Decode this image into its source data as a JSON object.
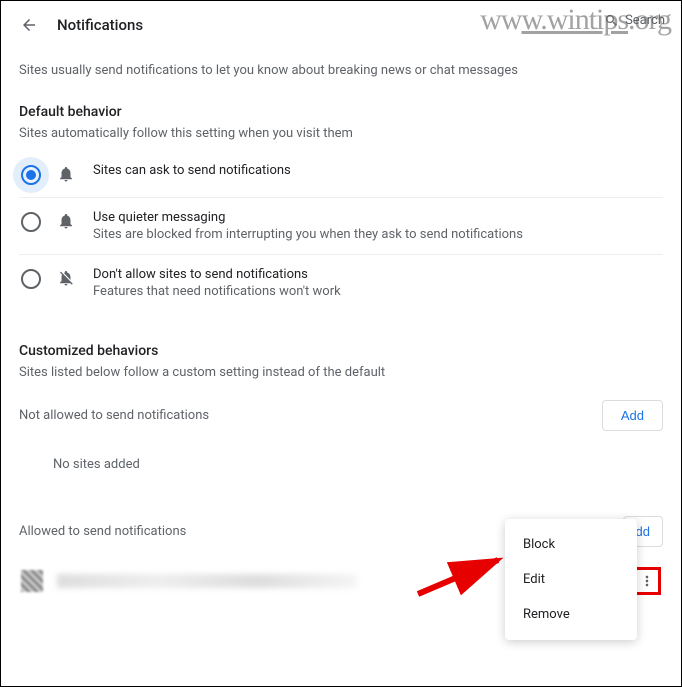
{
  "watermark": "www.wintips.org",
  "header": {
    "title": "Notifications",
    "search_placeholder": "Search"
  },
  "intro": "Sites usually send notifications to let you know about breaking news or chat messages",
  "default_behavior": {
    "title": "Default behavior",
    "desc": "Sites automatically follow this setting when you visit them",
    "options": [
      {
        "label": "Sites can ask to send notifications",
        "sub": "",
        "selected": true,
        "icon": "bell"
      },
      {
        "label": "Use quieter messaging",
        "sub": "Sites are blocked from interrupting you when they ask to send notifications",
        "selected": false,
        "icon": "bell"
      },
      {
        "label": "Don't allow sites to send notifications",
        "sub": "Features that need notifications won't work",
        "selected": false,
        "icon": "bell-off"
      }
    ]
  },
  "custom": {
    "title": "Customized behaviors",
    "desc": "Sites listed below follow a custom setting instead of the default"
  },
  "blocked_list": {
    "title": "Not allowed to send notifications",
    "add": "Add",
    "empty": "No sites added"
  },
  "allowed_list": {
    "title": "Allowed to send notifications",
    "add": "dd"
  },
  "context_menu": {
    "items": [
      "Block",
      "Edit",
      "Remove"
    ]
  }
}
